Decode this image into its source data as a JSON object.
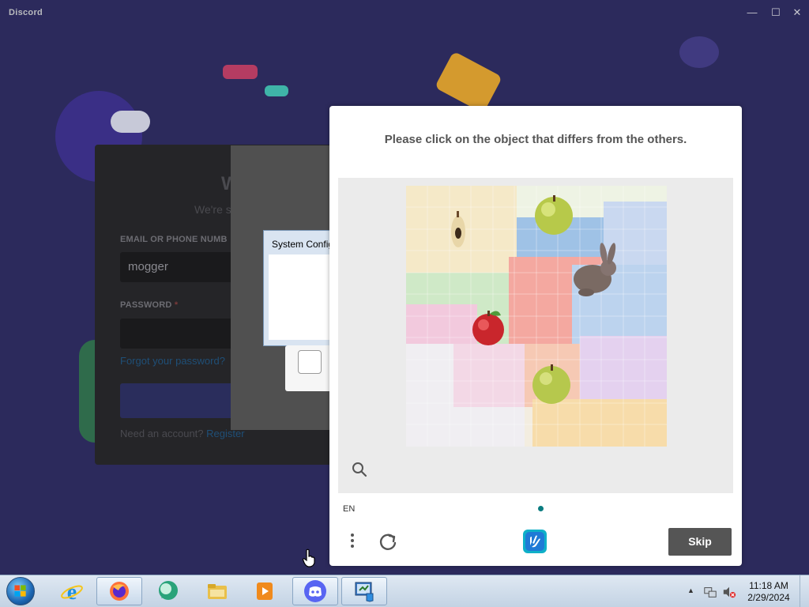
{
  "window": {
    "title": "Discord",
    "controls": {
      "minimize": "—",
      "maximize": "☐",
      "close": "✕"
    }
  },
  "login": {
    "welcome": "W",
    "subtitle": "We're s",
    "email_label": "EMAIL OR PHONE NUMB",
    "email_value": "mogger",
    "password_label": "PASSWORD",
    "required_mark": "*",
    "forgot": "Forgot your password?",
    "need_account": "Need an account?",
    "register": "Register"
  },
  "system_dialog": {
    "title": "System Configu"
  },
  "captcha": {
    "prompt": "Please click on the object that differs from the others.",
    "language": "EN",
    "skip_label": "Skip",
    "icons": {
      "zoom": "search-icon",
      "menu": "more-vertical-icon",
      "refresh": "refresh-icon",
      "logo": "hcaptcha-logo-icon"
    }
  },
  "taskbar": {
    "apps": [
      {
        "name": "internet-explorer"
      },
      {
        "name": "firefox"
      },
      {
        "name": "chat-app"
      },
      {
        "name": "file-explorer"
      },
      {
        "name": "media-player"
      },
      {
        "name": "discord"
      },
      {
        "name": "system-configuration"
      }
    ],
    "time": "11:18 AM",
    "date": "2/29/2024"
  }
}
